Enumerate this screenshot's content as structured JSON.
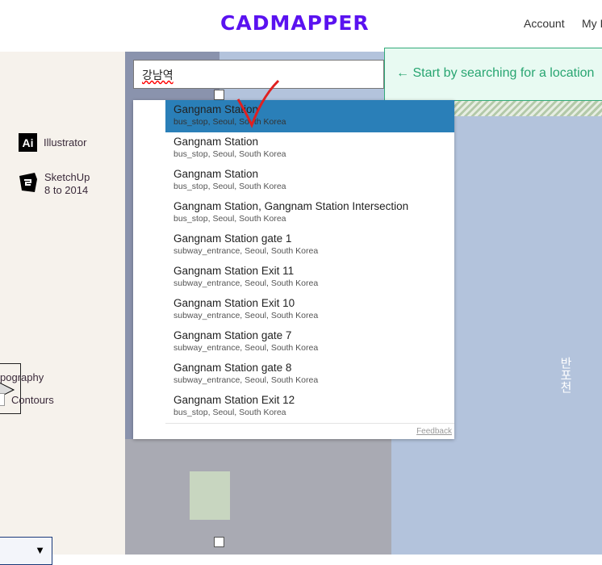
{
  "header": {
    "logo": "CADMAPPER",
    "nav": [
      "Account",
      "My I"
    ]
  },
  "left_panel": {
    "formats": [
      {
        "icon": "illustrator-icon",
        "label": "Illustrator"
      },
      {
        "icon": "sketchup-icon",
        "label": "SketchUp 8 to 2014"
      }
    ],
    "topography_label": "pography",
    "contours_label": "Contours",
    "select_arrow": "▼"
  },
  "search": {
    "value": "강남역"
  },
  "banner": {
    "text": "← Start by searching for a location"
  },
  "map": {
    "river_label": "반포천"
  },
  "results": [
    {
      "title": "Gangnam Station",
      "sub": "bus_stop, Seoul, South Korea",
      "selected": true
    },
    {
      "title": "Gangnam Station",
      "sub": "bus_stop, Seoul, South Korea"
    },
    {
      "title": "Gangnam Station",
      "sub": "bus_stop, Seoul, South Korea"
    },
    {
      "title": "Gangnam Station, Gangnam Station Intersection",
      "sub": "bus_stop, Seoul, South Korea"
    },
    {
      "title": "Gangnam Station gate 1",
      "sub": "subway_entrance, Seoul, South Korea"
    },
    {
      "title": "Gangnam Station Exit 11",
      "sub": "subway_entrance, Seoul, South Korea"
    },
    {
      "title": "Gangnam Station Exit 10",
      "sub": "subway_entrance, Seoul, South Korea"
    },
    {
      "title": "Gangnam Station gate 7",
      "sub": "subway_entrance, Seoul, South Korea"
    },
    {
      "title": "Gangnam Station gate 8",
      "sub": "subway_entrance, Seoul, South Korea"
    },
    {
      "title": "Gangnam Station Exit 12",
      "sub": "bus_stop, Seoul, South Korea"
    }
  ],
  "feedback": "Feedback",
  "colors": {
    "brand": "#5a12f0",
    "selected": "#2a7fb8",
    "banner": "#28a571"
  }
}
